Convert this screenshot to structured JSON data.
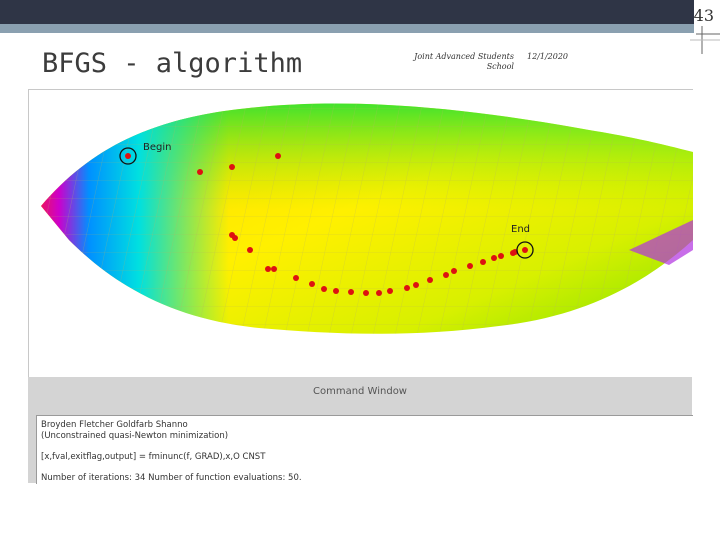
{
  "slide": {
    "number": "43",
    "title": "BFGS - algorithm",
    "footer_line1": "Joint Advanced Students",
    "footer_line2": "School",
    "date": "12/1/2020"
  },
  "plot": {
    "begin_label": "Begin",
    "end_label": "End"
  },
  "command_window": {
    "title": "Command Window",
    "lines": [
      "Broyden Fletcher Goldfarb Shanno",
      "(Unconstrained quasi-Newton minimization)",
      "[x,fval,exitflag,output] = fminunc(f, GRAD),x,O    CNST",
      "Number of iterations: 34    Number of function evaluations: 50."
    ]
  },
  "colors": {
    "header_dark": "#2f3546",
    "header_light": "#8aa0b0",
    "iteration_point": "#dd1111"
  }
}
